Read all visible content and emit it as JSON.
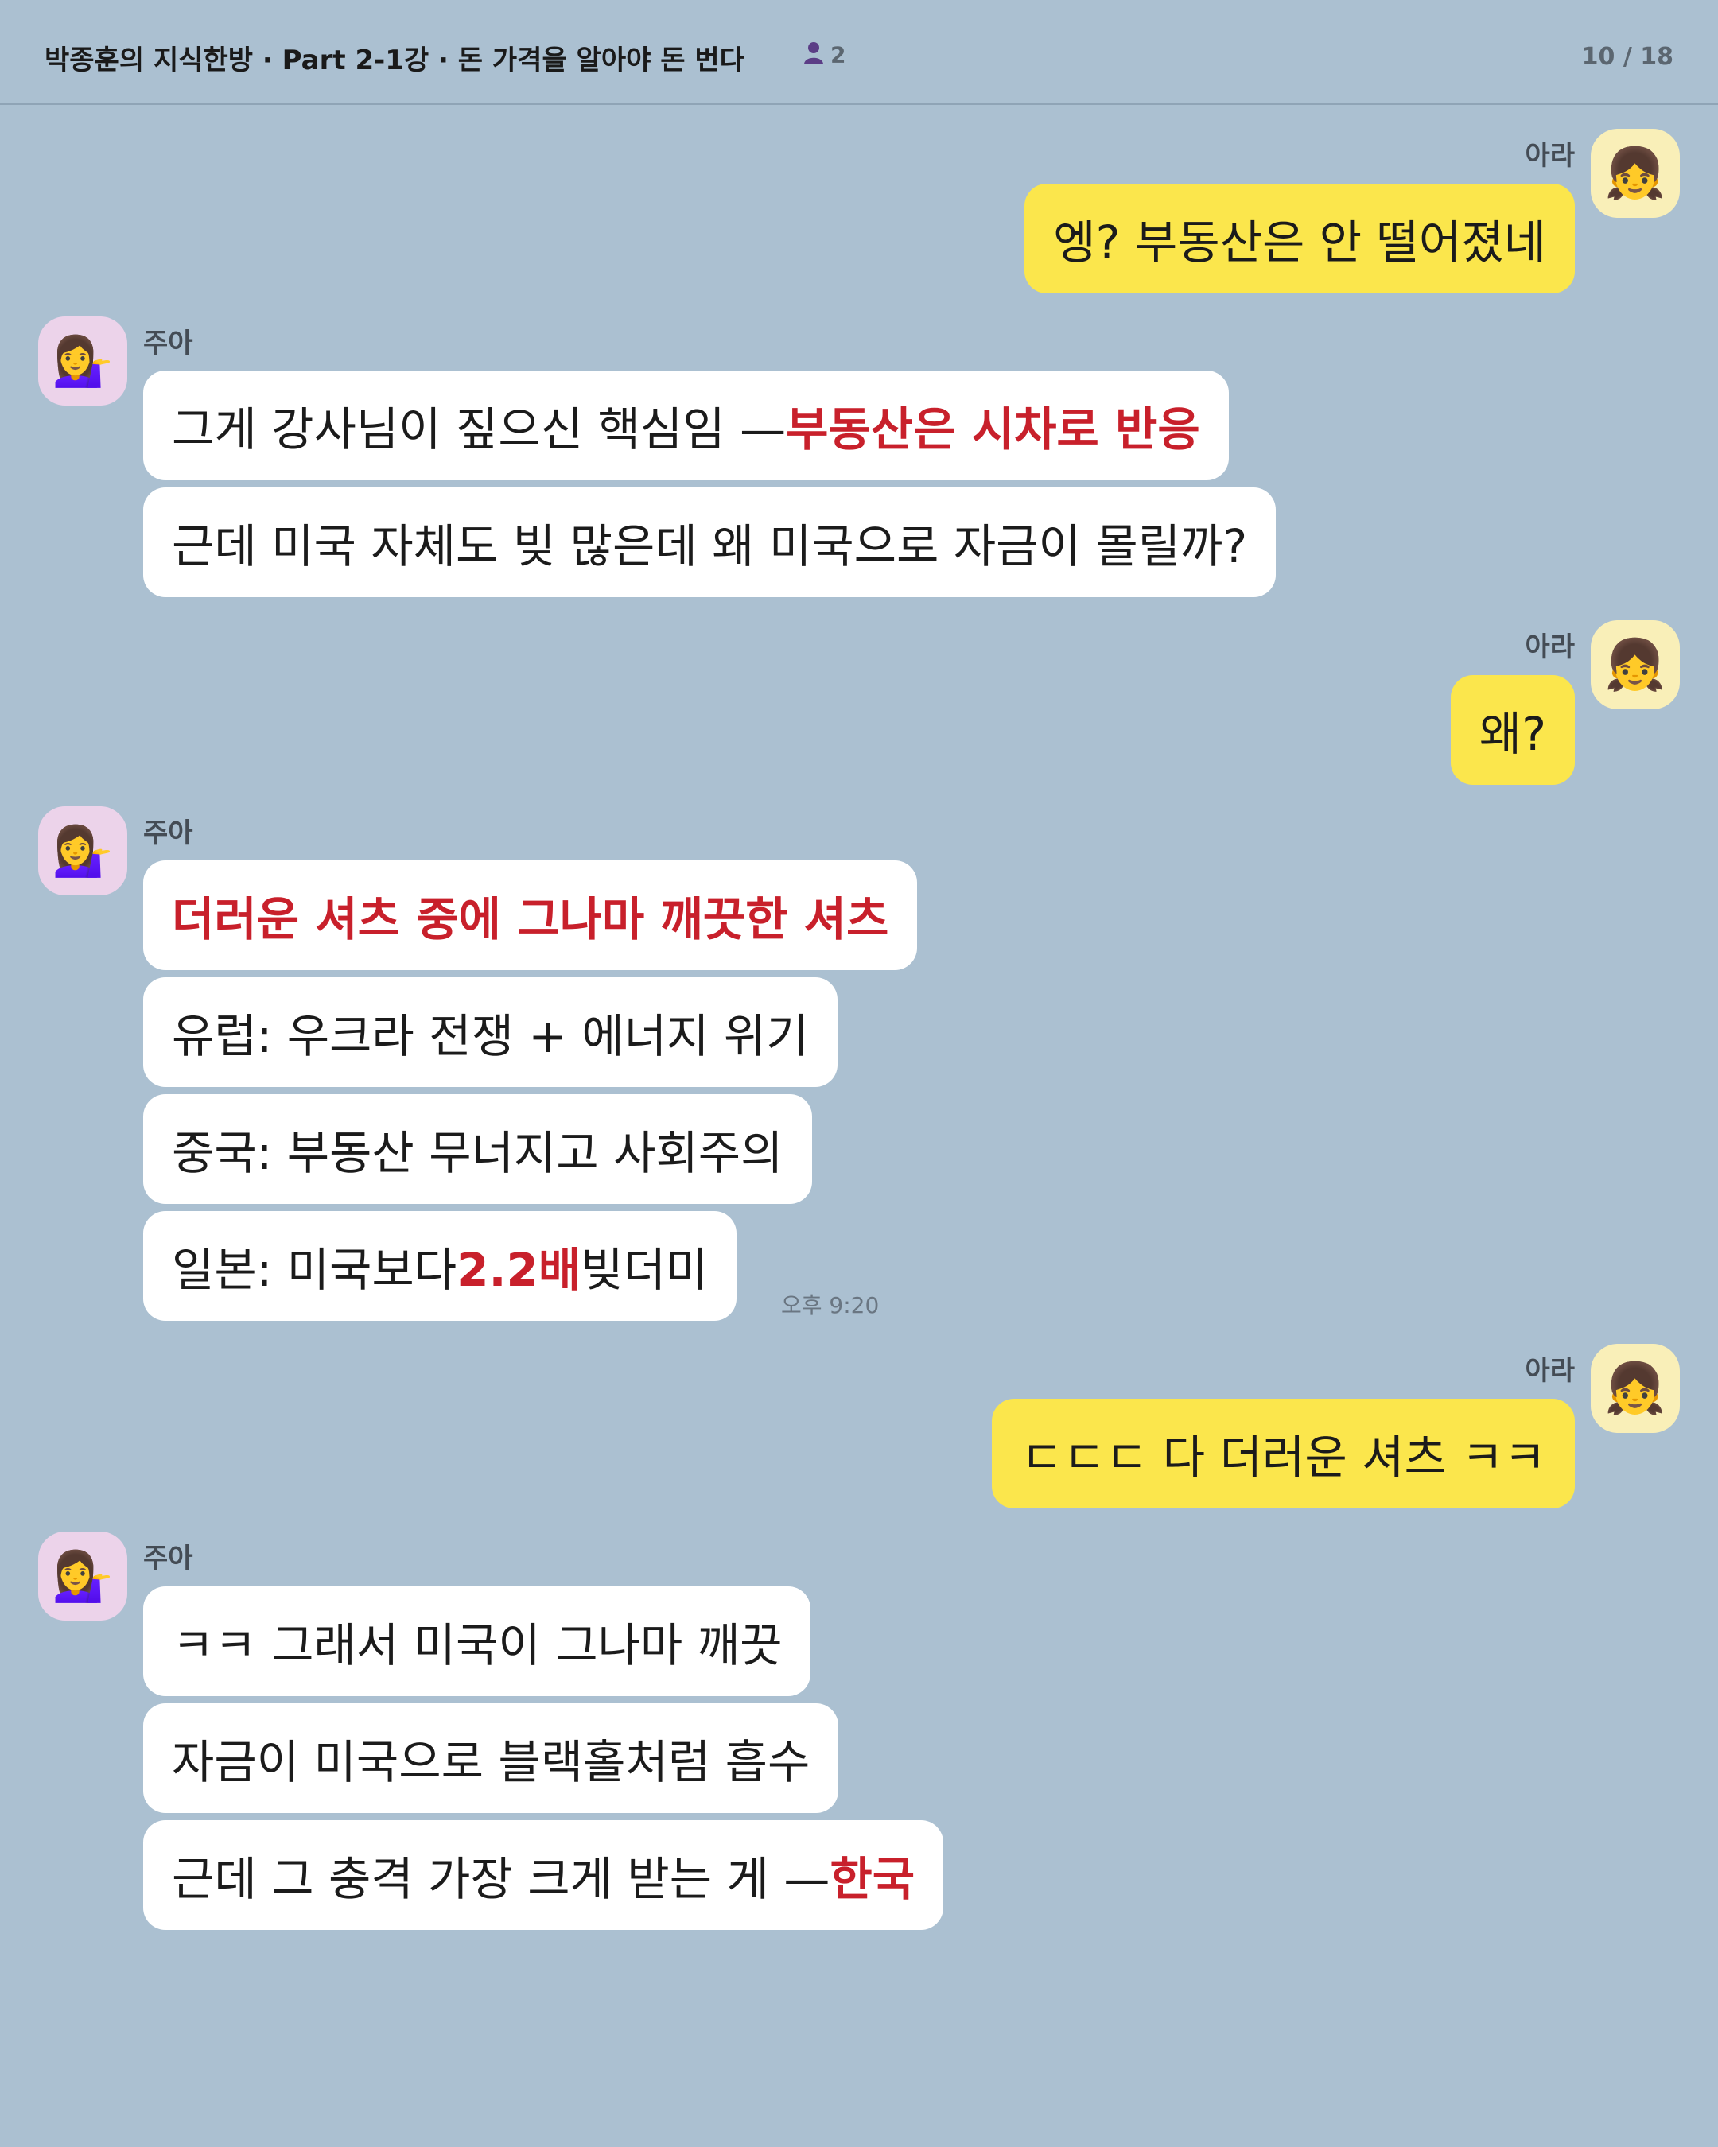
{
  "header": {
    "title": "박종훈의 지식한방 · Part 2-1강 · 돈 가격을 알아야 돈 번다",
    "member_count": "2",
    "page_indicator": "10 / 18"
  },
  "participants": {
    "me": {
      "name": "아라",
      "avatar_icon": "girl-emoji-icon",
      "avatar_glyph": "👧"
    },
    "other": {
      "name": "주아",
      "avatar_icon": "woman-tipping-hand-emoji-icon",
      "avatar_glyph": "💁‍♀️"
    }
  },
  "messages": {
    "m1": {
      "text": "엥? 부동산은 안 떨어졌네"
    },
    "m2": {
      "pre": "그게 강사님이 짚으신 핵심임 — ",
      "hl": "부동산은 시차로 반응"
    },
    "m3": {
      "text": "근데 미국 자체도 빚 많은데 왜 미국으로 자금이 몰릴까?"
    },
    "m4": {
      "text": "왜?"
    },
    "m5": {
      "hl": "더러운 셔츠 중에 그나마 깨끗한 셔츠"
    },
    "m6": {
      "text": "유럽: 우크라 전쟁 + 에너지 위기"
    },
    "m7": {
      "text": "중국: 부동산 무너지고 사회주의"
    },
    "m8": {
      "pre": "일본: 미국보다 ",
      "hl": "2.2배",
      "post": " 빚더미"
    },
    "m8_time": "오후 9:20",
    "m9": {
      "text": "ㄷㄷㄷ 다 더러운 셔츠 ㅋㅋ"
    },
    "m10": {
      "text": "ㅋㅋ 그래서 미국이 그나마 깨끗"
    },
    "m11": {
      "text": "자금이 미국으로 블랙홀처럼 흡수"
    },
    "m12": {
      "pre": "근데 그 충격 가장 크게 받는 게 — ",
      "hl": "한국"
    }
  },
  "colors": {
    "background": "#abc0d1",
    "my_bubble": "#fbe64c",
    "other_bubble": "#ffffff",
    "highlight": "#c8202b"
  }
}
